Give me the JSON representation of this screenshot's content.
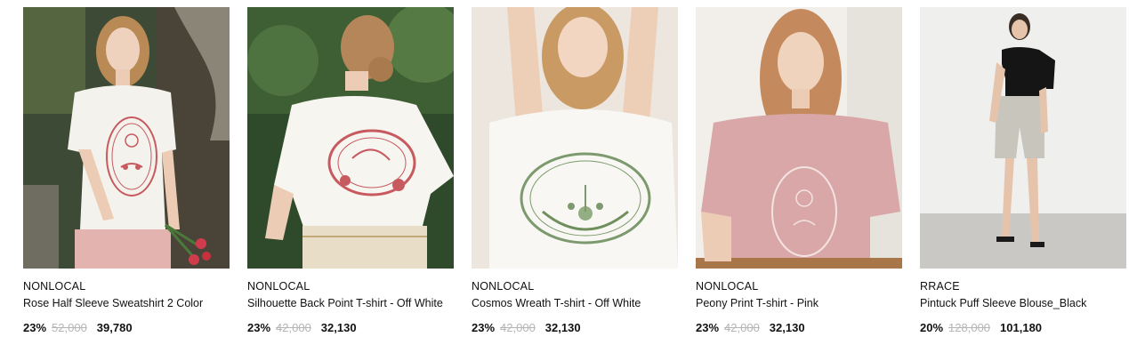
{
  "products": [
    {
      "brand": "NONLOCAL",
      "name": "Rose Half Sleeve Sweatshirt 2 Color",
      "discount": "23%",
      "original_price": "52,000",
      "sale_price": "39,780",
      "image_name": "product-photo-rose-sweatshirt"
    },
    {
      "brand": "NONLOCAL",
      "name": "Silhouette Back Point T-shirt - Off White",
      "discount": "23%",
      "original_price": "42,000",
      "sale_price": "32,130",
      "image_name": "product-photo-silhouette-tshirt"
    },
    {
      "brand": "NONLOCAL",
      "name": "Cosmos Wreath T-shirt - Off White",
      "discount": "23%",
      "original_price": "42,000",
      "sale_price": "32,130",
      "image_name": "product-photo-cosmos-tshirt"
    },
    {
      "brand": "NONLOCAL",
      "name": "Peony Print T-shirt - Pink",
      "discount": "23%",
      "original_price": "42,000",
      "sale_price": "32,130",
      "image_name": "product-photo-peony-tshirt"
    },
    {
      "brand": "RRACE",
      "name": "Pintuck Puff Sleeve Blouse_Black",
      "discount": "20%",
      "original_price": "128,000",
      "sale_price": "101,180",
      "image_name": "product-photo-pintuck-blouse"
    }
  ],
  "colors": {
    "text": "#111111",
    "strikethrough": "#b5b5b5",
    "rose_print": "#c75a5f",
    "wreath_print": "#7d9a6e"
  }
}
